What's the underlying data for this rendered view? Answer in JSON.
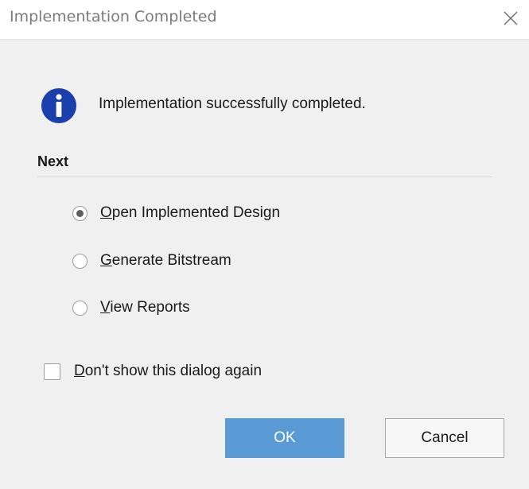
{
  "window": {
    "title": "Implementation Completed"
  },
  "message": {
    "text": "Implementation successfully completed.",
    "icon": "info-icon"
  },
  "next": {
    "label": "Next",
    "options": [
      {
        "mnemonic": "O",
        "rest": "pen Implemented Design",
        "selected": true
      },
      {
        "mnemonic": "G",
        "rest": "enerate Bitstream",
        "selected": false
      },
      {
        "mnemonic": "V",
        "rest": "iew Reports",
        "selected": false
      }
    ]
  },
  "dont_show": {
    "mnemonic": "D",
    "rest": "on't show this dialog again",
    "checked": false
  },
  "buttons": {
    "ok_label": "OK",
    "cancel_label": "Cancel"
  },
  "colors": {
    "ok_background": "#5b9bd5",
    "info_icon": "#1c3fae"
  }
}
